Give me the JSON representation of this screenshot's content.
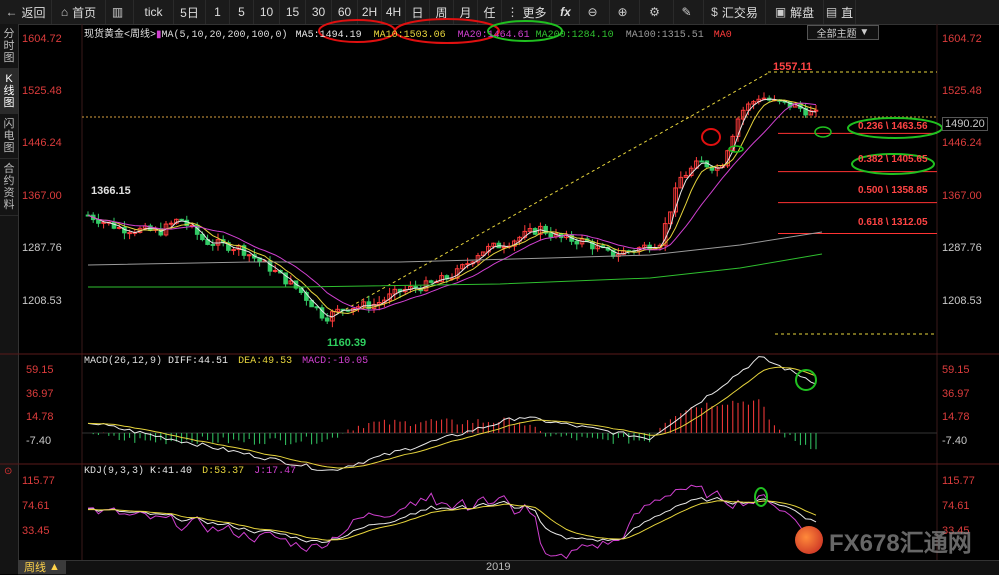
{
  "toolbar": {
    "items": [
      {
        "icon": "←",
        "label": "返回"
      },
      {
        "icon": "⌂",
        "label": "首页"
      },
      {
        "icon": "▥",
        "label": ""
      },
      {
        "icon": "",
        "label": "tick"
      },
      {
        "icon": "",
        "label": "5日"
      },
      {
        "icon": "",
        "label": "1"
      },
      {
        "icon": "",
        "label": "5"
      },
      {
        "icon": "",
        "label": "10"
      },
      {
        "icon": "",
        "label": "15"
      },
      {
        "icon": "",
        "label": "30"
      },
      {
        "icon": "",
        "label": "60"
      },
      {
        "icon": "",
        "label": "2H"
      },
      {
        "icon": "",
        "label": "4H"
      },
      {
        "icon": "",
        "label": "日"
      },
      {
        "icon": "",
        "label": "周"
      },
      {
        "icon": "",
        "label": "月"
      },
      {
        "icon": "",
        "label": "任"
      },
      {
        "icon": "⋮",
        "label": "更多"
      },
      {
        "icon": "",
        "label": "fx"
      },
      {
        "icon": "⊖",
        "label": ""
      },
      {
        "icon": "⊕",
        "label": ""
      },
      {
        "icon": "⚙",
        "label": ""
      },
      {
        "icon": "✎",
        "label": ""
      },
      {
        "icon": "$",
        "label": "汇交易"
      },
      {
        "icon": "▣",
        "label": "解盘"
      },
      {
        "icon": "▤",
        "label": "直"
      }
    ]
  },
  "sidebar": {
    "items": [
      "分时图",
      "K线图",
      "闪电图",
      "合约资料"
    ],
    "active": 1
  },
  "theme_button": "全部主题",
  "legend": {
    "instrument": "现货黄金<周线>",
    "ma_params": "MA(5,10,20,200,100,0)",
    "ma5": "MA5:1494.19",
    "ma10": "MA10:1503.06",
    "ma20": "MA20:1464.61",
    "ma200": "MA200:1284.10",
    "ma100": "MA100:1315.51",
    "ma0": "MA0",
    "macd_params": "MACD(26,12,9)",
    "diff": "DIFF:44.51",
    "dea": "DEA:49.53",
    "macd": "MACD:-10.05",
    "kdj_params": "KDJ(9,3,3)",
    "k": "K:41.40",
    "d": "D:53.37",
    "j": "J:17.47"
  },
  "price_axis": [
    "1604.72",
    "1525.48",
    "1446.24",
    "1367.00",
    "1287.76",
    "1208.53"
  ],
  "macd_axis": [
    "59.15",
    "36.97",
    "14.78",
    "-7.40"
  ],
  "kdj_axis": [
    "115.77",
    "74.61",
    "33.45"
  ],
  "current_price": "1490.20",
  "annotations": {
    "high": "1557.11",
    "prior_high": "1366.15",
    "low": "1160.39"
  },
  "fib_levels": [
    {
      "label": "0.236 \\ 1463.56",
      "value": 1463.56
    },
    {
      "label": "0.382 \\ 1405.65",
      "value": 1405.65
    },
    {
      "label": "0.500 \\ 1358.85",
      "value": 1358.85
    },
    {
      "label": "0.618 \\ 1312.05",
      "value": 1312.05
    }
  ],
  "period_label": "周线",
  "year_label": "2019",
  "watermark": "FX678汇通网",
  "colors": {
    "up": "#ff3b3b",
    "down": "#33cc66",
    "ma5": "#e8e8e8",
    "ma10": "#e6d43c",
    "ma20": "#d040d0",
    "ma100": "#9a9a9a",
    "ma200": "#2fbf2f",
    "fib": "#ff3333",
    "circle_red": "#e01010",
    "circle_green": "#20c020"
  }
}
